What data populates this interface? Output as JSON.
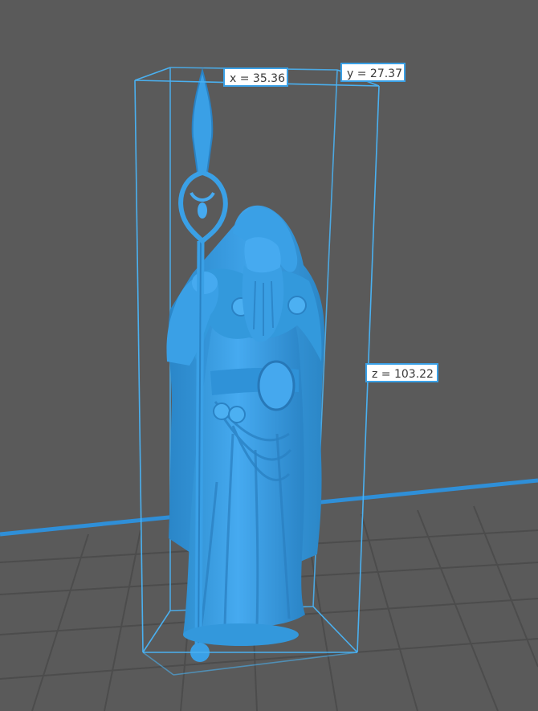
{
  "viewport": {
    "background_color": "#5a5a5a",
    "grid_color": "#4a4a4a",
    "axis_color": "#2f8fd8",
    "model_color": "#3aa0e6",
    "bounding_box_color": "#4ab0f0"
  },
  "dimensions": {
    "x_label": "x = 35.36",
    "y_label": "y = 27.37",
    "z_label": "z = 103.22"
  }
}
